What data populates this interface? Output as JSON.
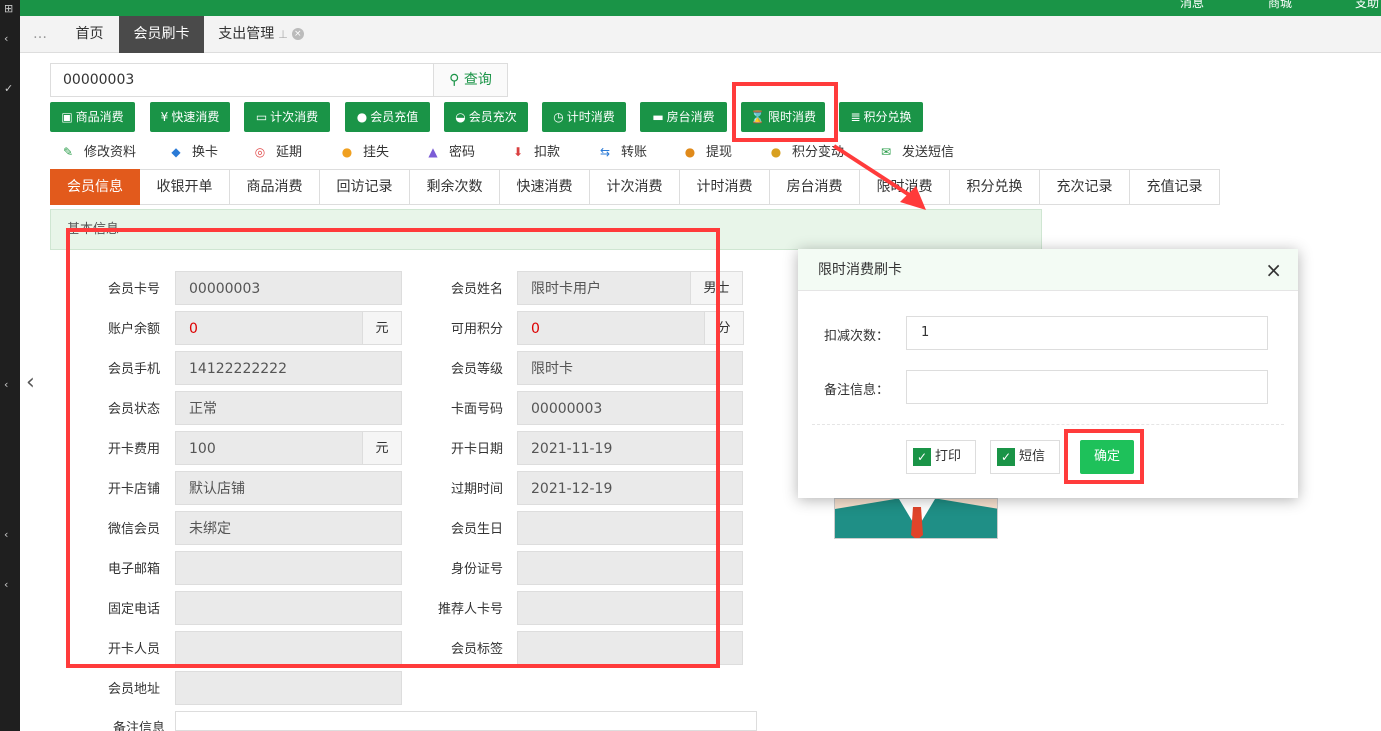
{
  "topbar": {
    "items": [
      "消息",
      "商城",
      "支助"
    ]
  },
  "tabs": [
    {
      "label": "首页"
    },
    {
      "label": "会员刷卡"
    },
    {
      "label": "支出管理"
    }
  ],
  "search": {
    "value": "00000003",
    "button": "查询"
  },
  "action_buttons": [
    "商品消费",
    "快速消费",
    "计次消费",
    "会员充值",
    "会员充次",
    "计时消费",
    "房台消费",
    "限时消费",
    "积分兑换"
  ],
  "action_icons": [
    "bag-icon",
    "yen-icon",
    "card-icon",
    "coin-icon",
    "cup-icon",
    "clock-icon",
    "bed-icon",
    "hourglass-icon",
    "database-icon"
  ],
  "links": [
    "修改资料",
    "换卡",
    "延期",
    "挂失",
    "密码",
    "扣款",
    "转账",
    "提现",
    "积分变动",
    "发送短信"
  ],
  "link_colors": [
    "#2a9d4a",
    "#2a7ad6",
    "#e04a4a",
    "#f0a020",
    "#7b5cd6",
    "#d94040",
    "#2a7ad6",
    "#e08a1a",
    "#d8a020",
    "#2a9d4a"
  ],
  "page_tabs": [
    "会员信息",
    "收银开单",
    "商品消费",
    "回访记录",
    "剩余次数",
    "快速消费",
    "计次消费",
    "计时消费",
    "房台消费",
    "限时消费",
    "积分兑换",
    "充次记录",
    "充值记录"
  ],
  "info_title": "基本信息",
  "fields_left": [
    {
      "label": "会员卡号",
      "value": "00000003"
    },
    {
      "label": "账户余额",
      "value": "0",
      "unit": "元"
    },
    {
      "label": "会员手机",
      "value": "14122222222"
    },
    {
      "label": "会员状态",
      "value": "正常"
    },
    {
      "label": "开卡费用",
      "value": "100",
      "unit": "元"
    },
    {
      "label": "开卡店铺",
      "value": "默认店铺"
    },
    {
      "label": "微信会员",
      "value": "未绑定"
    },
    {
      "label": "电子邮箱",
      "value": ""
    },
    {
      "label": "固定电话",
      "value": ""
    },
    {
      "label": "开卡人员",
      "value": ""
    },
    {
      "label": "会员地址",
      "value": ""
    },
    {
      "label": "备注信息",
      "value": ""
    }
  ],
  "fields_right": [
    {
      "label": "会员姓名",
      "value": "限时卡用户",
      "unit": "男士"
    },
    {
      "label": "可用积分",
      "value": "0",
      "unit": "分"
    },
    {
      "label": "会员等级",
      "value": "限时卡"
    },
    {
      "label": "卡面号码",
      "value": "00000003"
    },
    {
      "label": "开卡日期",
      "value": "2021-11-19"
    },
    {
      "label": "过期时间",
      "value": "2021-12-19"
    },
    {
      "label": "会员生日",
      "value": ""
    },
    {
      "label": "身份证号",
      "value": ""
    },
    {
      "label": "推荐人卡号",
      "value": ""
    },
    {
      "label": "会员标签",
      "value": ""
    }
  ],
  "modal": {
    "title": "限时消费刷卡",
    "deduct_label": "扣减次数：",
    "deduct_value": "1",
    "remark_label": "备注信息：",
    "remark_value": "",
    "print_label": "打印",
    "sms_label": "短信",
    "confirm_label": "确定"
  },
  "colors": {
    "brand": "#1a9447",
    "highlight": "#ff3b3b",
    "active_tab": "#e25a1c"
  }
}
